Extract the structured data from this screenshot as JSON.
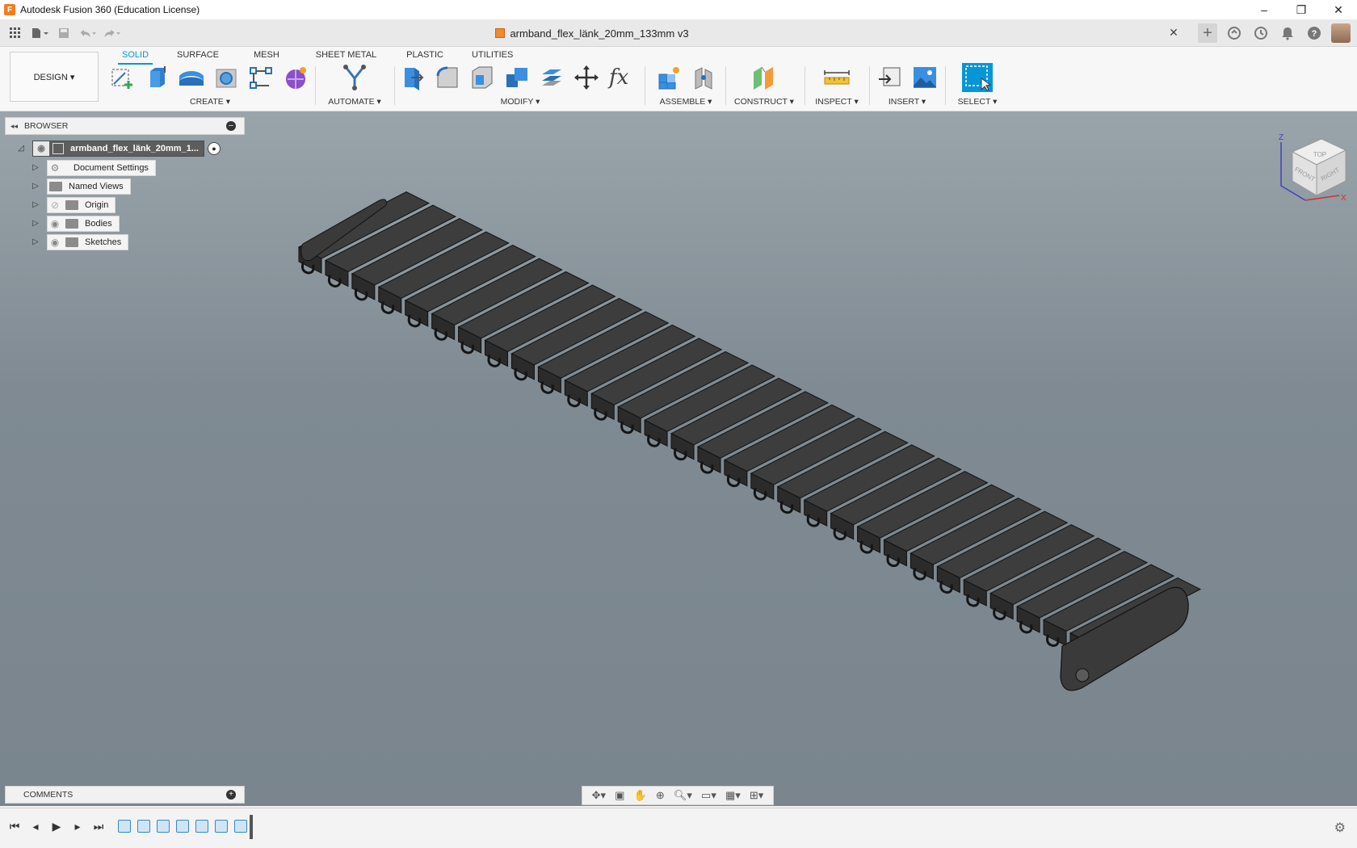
{
  "window": {
    "title": "Autodesk Fusion 360 (Education License)",
    "controls": [
      "–",
      "❐",
      "✕"
    ]
  },
  "document": {
    "tab_name": "armband_flex_länk_20mm_133mm v3",
    "close": "✕"
  },
  "ribbon": {
    "workspace": "DESIGN ▾",
    "tabs": [
      "SOLID",
      "SURFACE",
      "MESH",
      "SHEET METAL",
      "PLASTIC",
      "UTILITIES"
    ],
    "active_tab": "SOLID",
    "groups": {
      "create": "CREATE ▾",
      "automate": "AUTOMATE ▾",
      "modify": "MODIFY ▾",
      "assemble": "ASSEMBLE ▾",
      "construct": "CONSTRUCT ▾",
      "inspect": "INSPECT ▾",
      "insert": "INSERT ▾",
      "select": "SELECT ▾"
    }
  },
  "browser": {
    "title": "BROWSER",
    "root": "armband_flex_länk_20mm_1...",
    "items": [
      "Document Settings",
      "Named Views",
      "Origin",
      "Bodies",
      "Sketches"
    ]
  },
  "comments": {
    "title": "COMMENTS"
  },
  "viewcube": {
    "top": "TOP",
    "front": "FRONT",
    "right": "RIGHT",
    "z": "Z",
    "x": "X"
  },
  "colors": {
    "accent": "#0696d7",
    "viewport_top": "#9aa4ab",
    "viewport_bottom": "#7a858d",
    "model": "#3a3a3a"
  }
}
